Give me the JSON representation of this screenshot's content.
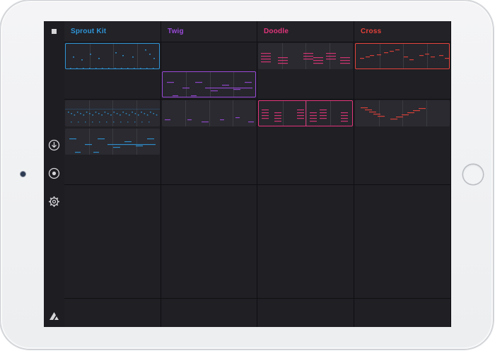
{
  "app": {
    "colors": {
      "sprout": "#2f95d6",
      "twig": "#9a49d8",
      "doodle": "#e2357a",
      "cross": "#e5413a",
      "icon": "#d6d6d9"
    },
    "sidebar": {
      "stop_icon": "stop-icon",
      "buttons": [
        {
          "name": "download-icon"
        },
        {
          "name": "record-icon"
        },
        {
          "name": "gear-icon"
        }
      ],
      "logo": "app-logo-icon"
    },
    "tracks": [
      {
        "name": "Sprout Kit",
        "color": "#2f95d6"
      },
      {
        "name": "Twig",
        "color": "#9a49d8"
      },
      {
        "name": "Doodle",
        "color": "#e2357a"
      },
      {
        "name": "Cross",
        "color": "#e5413a"
      }
    ],
    "rows": 10,
    "clips": [
      {
        "col": 0,
        "row": 0,
        "selected": true,
        "pattern": "kit-sparse"
      },
      {
        "col": 0,
        "row": 2,
        "selected": false,
        "pattern": "kit-dense"
      },
      {
        "col": 0,
        "row": 3,
        "selected": false,
        "pattern": "bass"
      },
      {
        "col": 1,
        "row": 1,
        "selected": true,
        "pattern": "bass"
      },
      {
        "col": 1,
        "row": 2,
        "selected": false,
        "pattern": "low"
      },
      {
        "col": 2,
        "row": 0,
        "selected": false,
        "pattern": "chords"
      },
      {
        "col": 2,
        "row": 2,
        "selected": true,
        "pattern": "chords-b"
      },
      {
        "col": 3,
        "row": 0,
        "selected": true,
        "pattern": "melody"
      },
      {
        "col": 3,
        "row": 2,
        "selected": false,
        "pattern": "stairs"
      }
    ]
  }
}
